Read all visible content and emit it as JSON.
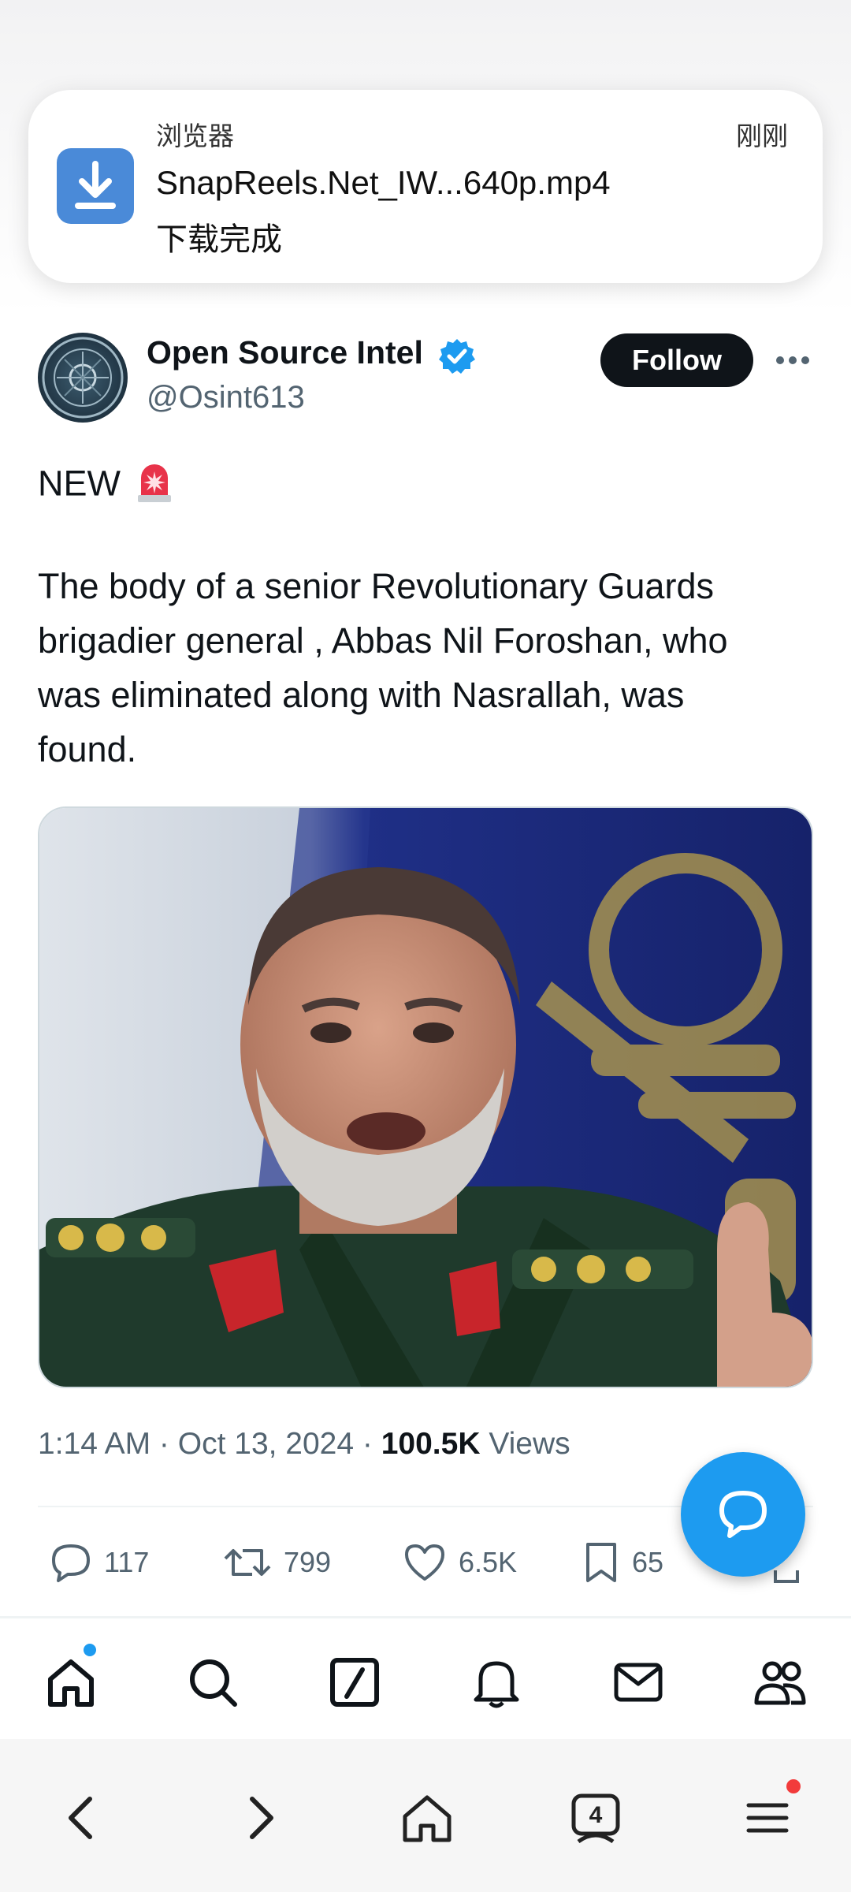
{
  "notification": {
    "app": "浏览器",
    "time": "刚刚",
    "title": "SnapReels.Net_IW...640p.mp4",
    "status": "下载完成",
    "icon": "download-icon",
    "icon_color": "#4a8ad8"
  },
  "tweet": {
    "author_name": "Open Source Intel",
    "handle": "@Osint613",
    "follow_label": "Follow",
    "line0": "NEW",
    "alert_icon": "police-light-emoji",
    "body_lines": [
      "The body of a senior Revolutionary Guards",
      "brigadier general , Abbas Nil Foroshan, who",
      "was eliminated along with Nasrallah, was",
      "found."
    ],
    "timestamp": "1:14 AM · Oct 13, 2024 · ",
    "views_count": "100.5K",
    "views_label": " Views",
    "replies": "117",
    "retweets": "799",
    "likes": "6.5K",
    "bookmarks": "65"
  },
  "colors": {
    "accent": "#1d9bf0",
    "text": "#0f1419",
    "secondary": "#536471",
    "notification_dot_red": "#f23b3b"
  },
  "tabbar": [
    "home-icon",
    "search-icon",
    "grok-icon",
    "notifications-icon",
    "messages-icon",
    "communities-icon"
  ],
  "browser_nav": [
    "back-icon",
    "forward-icon",
    "home-icon",
    "tabs-icon",
    "menu-icon"
  ],
  "browser_tab_count": "4"
}
